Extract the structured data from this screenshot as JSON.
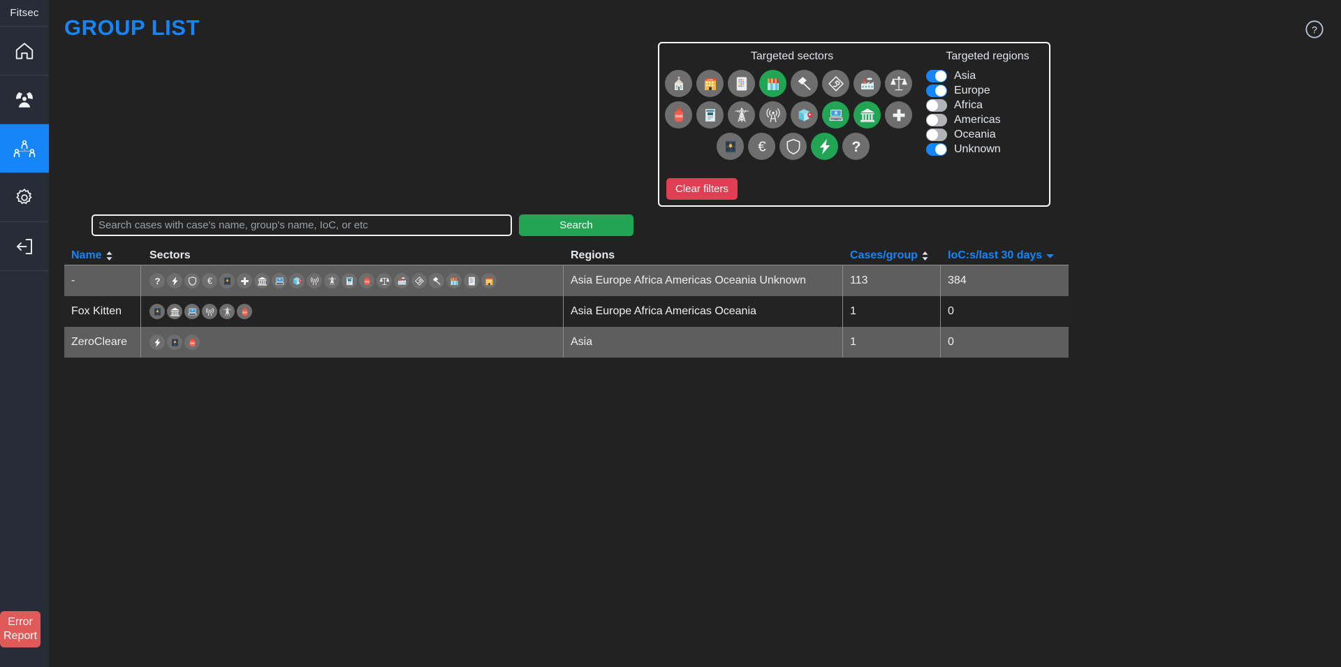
{
  "brand": {
    "name": "Fitsec"
  },
  "sidebar": {
    "items": [
      {
        "icon": "home-icon",
        "name": "sidebar-item-home",
        "active": false
      },
      {
        "icon": "radiation-person-icon",
        "name": "sidebar-item-threats",
        "active": false
      },
      {
        "icon": "group-people-icon",
        "name": "sidebar-item-groups",
        "active": true
      },
      {
        "icon": "gear-icon",
        "name": "sidebar-item-settings",
        "active": false
      },
      {
        "icon": "logout-icon",
        "name": "sidebar-item-logout",
        "active": false
      }
    ],
    "error_report_label": "Error\nReport",
    "error_report_line1": "Error",
    "error_report_line2": "Report",
    "error_report_color": "#e05a5a"
  },
  "header": {
    "title": "GROUP LIST",
    "title_color": "#1685f8",
    "help_icon": "question-circle-icon"
  },
  "filters": {
    "sectors_title": "Targeted sectors",
    "regions_title": "Targeted regions",
    "clear_label": "Clear filters",
    "clear_color": "#e03e52",
    "active_color": "#21a453",
    "inactive_color": "#6e6e6e",
    "sectors": [
      {
        "name": "church",
        "glyph": "⛪",
        "selected": false
      },
      {
        "name": "hotel",
        "glyph": "🏨",
        "selected": false
      },
      {
        "name": "tablet-apps",
        "glyph": "📱",
        "selected": false
      },
      {
        "name": "retail-store",
        "glyph": "🏪",
        "selected": true
      },
      {
        "name": "hammer-construction",
        "glyph": "🔨",
        "selected": false
      },
      {
        "name": "engineering-wrench",
        "glyph": "🛠",
        "selected": false
      },
      {
        "name": "factory",
        "glyph": "🏭",
        "selected": false
      },
      {
        "name": "legal-scales",
        "glyph": "⚖",
        "selected": false
      },
      {
        "name": "gas-cylinder",
        "glyph": "GAS",
        "selected": false
      },
      {
        "name": "media-document",
        "glyph": "📰",
        "selected": false
      },
      {
        "name": "power-pylon",
        "glyph": "🗼",
        "selected": false
      },
      {
        "name": "telecom-antenna",
        "glyph": "📡",
        "selected": false
      },
      {
        "name": "logistics-package",
        "glyph": "📦",
        "selected": false
      },
      {
        "name": "technology-laptop",
        "glyph": "💻",
        "selected": true
      },
      {
        "name": "government-bank",
        "glyph": "🏛",
        "selected": true
      },
      {
        "name": "healthcare-cross",
        "glyph": "➕",
        "selected": false
      },
      {
        "name": "oil-barrel",
        "glyph": "🛢",
        "selected": false
      },
      {
        "name": "finance-euro",
        "glyph": "€",
        "selected": false
      },
      {
        "name": "defense-shield",
        "glyph": "🛡",
        "selected": false
      },
      {
        "name": "energy-bolt",
        "glyph": "⚡",
        "selected": true
      },
      {
        "name": "unknown-question",
        "glyph": "?",
        "selected": false
      }
    ],
    "regions": [
      {
        "label": "Asia",
        "enabled": true
      },
      {
        "label": "Europe",
        "enabled": true
      },
      {
        "label": "Africa",
        "enabled": false
      },
      {
        "label": "Americas",
        "enabled": false
      },
      {
        "label": "Oceania",
        "enabled": false
      },
      {
        "label": "Unknown",
        "enabled": true
      }
    ]
  },
  "search": {
    "placeholder": "Search cases with case's name, group's name, IoC, or etc",
    "value": "",
    "button_label": "Search",
    "button_color": "#21a453"
  },
  "table": {
    "columns": [
      {
        "label": "Name",
        "sortable": true,
        "sort_icon": "sort-updown-icon"
      },
      {
        "label": "Sectors",
        "sortable": false
      },
      {
        "label": "Regions",
        "sortable": false
      },
      {
        "label": "Cases/group",
        "sortable": true,
        "sort_icon": "sort-updown-icon"
      },
      {
        "label": "IoC:s/last 30 days",
        "sortable": true,
        "sort_icon": "chevron-down-icon"
      }
    ],
    "rows": [
      {
        "name": "-",
        "sectors": [
          "unknown-question",
          "energy-bolt",
          "defense-shield",
          "finance-euro",
          "oil-barrel",
          "healthcare-cross",
          "government-bank",
          "technology-laptop",
          "logistics-package",
          "telecom-antenna",
          "power-pylon",
          "media-document",
          "gas-cylinder",
          "legal-scales",
          "factory",
          "engineering-wrench",
          "hammer-construction",
          "retail-store",
          "tablet-apps",
          "hotel"
        ],
        "regions": "Asia Europe Africa Americas Oceania Unknown",
        "cases_per_group": "113",
        "iocs_last_30_days": "384"
      },
      {
        "name": "Fox Kitten",
        "sectors": [
          "oil-barrel",
          "government-bank",
          "technology-laptop",
          "telecom-antenna",
          "power-pylon",
          "gas-cylinder"
        ],
        "regions": "Asia Europe Africa Americas Oceania",
        "cases_per_group": "1",
        "iocs_last_30_days": "0"
      },
      {
        "name": "ZeroCleare",
        "sectors": [
          "energy-bolt",
          "oil-barrel",
          "gas-cylinder"
        ],
        "regions": "Asia",
        "cases_per_group": "1",
        "iocs_last_30_days": "0"
      }
    ]
  }
}
